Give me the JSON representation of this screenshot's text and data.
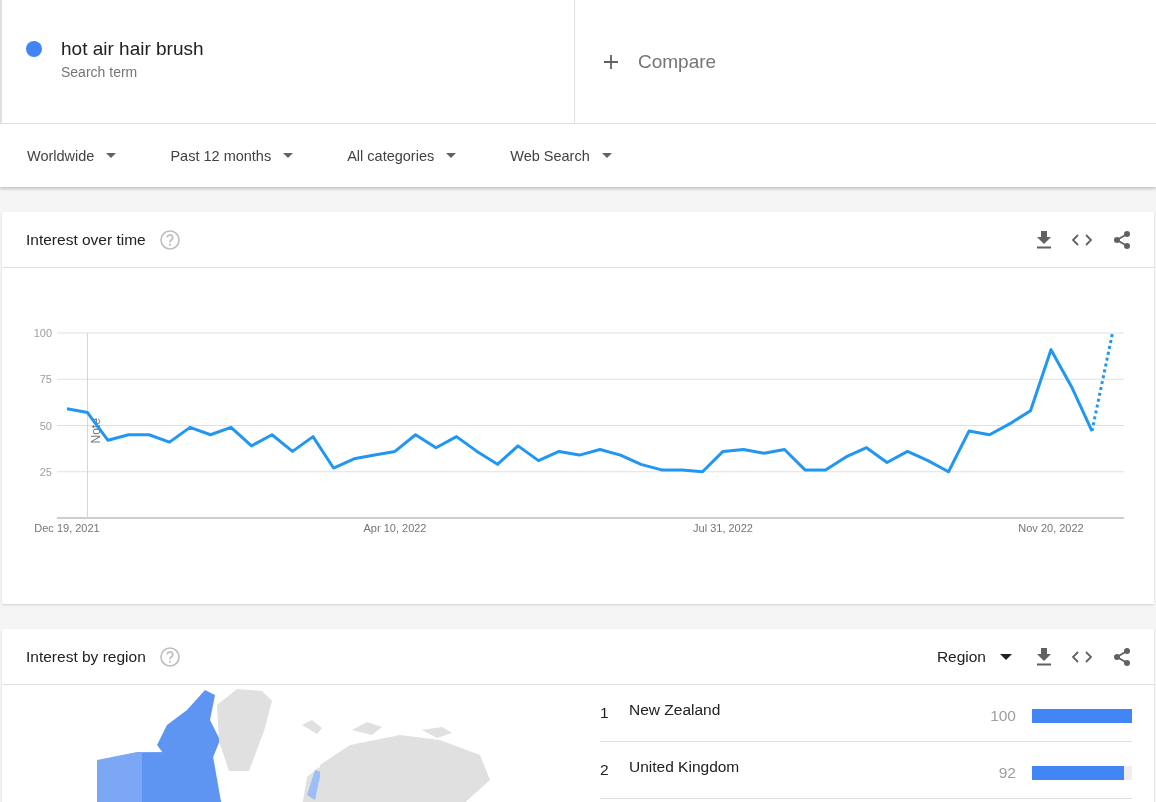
{
  "search_terms": [
    {
      "term": "hot air hair brush",
      "subtitle": "Search term",
      "color": "#4285f4"
    }
  ],
  "compare": {
    "label": "Compare"
  },
  "filters": [
    {
      "label": "Worldwide"
    },
    {
      "label": "Past 12 months"
    },
    {
      "label": "All categories"
    },
    {
      "label": "Web Search"
    }
  ],
  "interest_over_time": {
    "title": "Interest over time",
    "last_point_partial": true,
    "chart_data": {
      "type": "line",
      "categories": [
        "Dec 19, 2021",
        null,
        null,
        null,
        null,
        null,
        null,
        null,
        null,
        null,
        null,
        null,
        null,
        null,
        null,
        null,
        "Apr 10, 2022",
        null,
        null,
        null,
        null,
        null,
        null,
        null,
        null,
        null,
        null,
        null,
        null,
        null,
        null,
        null,
        "Jul 31, 2022",
        null,
        null,
        null,
        null,
        null,
        null,
        null,
        null,
        null,
        null,
        null,
        null,
        null,
        null,
        null,
        "Nov 20, 2022",
        null,
        null,
        null
      ],
      "series": [
        {
          "color": "#2196f3",
          "values": [
            59,
            57,
            42,
            45,
            45,
            41,
            49,
            45,
            49,
            39,
            45,
            36,
            44,
            27,
            32,
            34,
            36,
            45,
            38,
            44,
            36,
            29,
            39,
            31,
            36,
            34,
            37,
            34,
            29,
            26,
            26,
            25,
            36,
            37,
            35,
            37,
            26,
            26,
            33,
            38,
            30,
            36,
            31,
            25,
            47,
            45,
            51,
            58,
            91,
            71,
            47,
            100
          ]
        }
      ],
      "ylim": [
        0,
        100
      ],
      "yticks": [
        25,
        50,
        75,
        100
      ],
      "grid": true,
      "annotations": [
        "Note"
      ]
    }
  },
  "interest_by_region": {
    "title": "Interest by region",
    "resolution": "Region",
    "rows": [
      {
        "rank": "1",
        "name": "New Zealand",
        "value": "100",
        "level": 1.0
      },
      {
        "rank": "2",
        "name": "United Kingdom",
        "value": "92",
        "level": 0.92
      }
    ]
  }
}
